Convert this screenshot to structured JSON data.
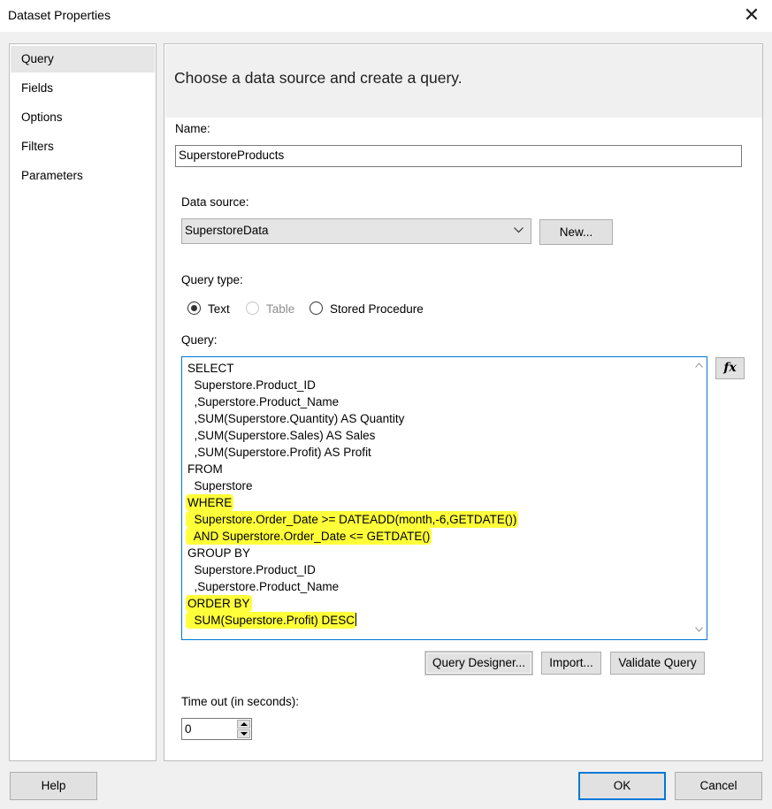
{
  "window": {
    "title": "Dataset Properties",
    "close_icon": "close-icon"
  },
  "sidebar": {
    "items": [
      {
        "label": "Query",
        "selected": true
      },
      {
        "label": "Fields",
        "selected": false
      },
      {
        "label": "Options",
        "selected": false
      },
      {
        "label": "Filters",
        "selected": false
      },
      {
        "label": "Parameters",
        "selected": false
      }
    ]
  },
  "panel": {
    "header": "Choose a data source and create a query.",
    "name_label": "Name:",
    "name_value": "SuperstoreProducts",
    "datasource_label": "Data source:",
    "datasource_value": "SuperstoreData",
    "new_button": "New...",
    "query_type_label": "Query type:",
    "query_types": [
      {
        "label": "Text",
        "selected": true,
        "enabled": true
      },
      {
        "label": "Table",
        "selected": false,
        "enabled": false
      },
      {
        "label": "Stored Procedure",
        "selected": false,
        "enabled": true
      }
    ],
    "query_label": "Query:",
    "query_lines": [
      {
        "text": "SELECT",
        "highlighted": false
      },
      {
        "text": "  Superstore.Product_ID",
        "highlighted": false
      },
      {
        "text": "  ,Superstore.Product_Name",
        "highlighted": false
      },
      {
        "text": "  ,SUM(Superstore.Quantity) AS Quantity",
        "highlighted": false
      },
      {
        "text": "  ,SUM(Superstore.Sales) AS Sales",
        "highlighted": false
      },
      {
        "text": "  ,SUM(Superstore.Profit) AS Profit",
        "highlighted": false
      },
      {
        "text": "FROM",
        "highlighted": false
      },
      {
        "text": "  Superstore",
        "highlighted": false
      },
      {
        "text": "WHERE",
        "highlighted": true
      },
      {
        "text": "  Superstore.Order_Date >= DATEADD(month,-6,GETDATE())",
        "highlighted": true
      },
      {
        "text": "  AND Superstore.Order_Date <= GETDATE()",
        "highlighted": true
      },
      {
        "text": "GROUP BY",
        "highlighted": false
      },
      {
        "text": "  Superstore.Product_ID",
        "highlighted": false
      },
      {
        "text": "  ,Superstore.Product_Name",
        "highlighted": false
      },
      {
        "text": "ORDER BY",
        "highlighted": true
      },
      {
        "text": "  SUM(Superstore.Profit) DESC",
        "highlighted": true
      }
    ],
    "fx_button": "fx",
    "query_designer_button": "Query Designer...",
    "import_button": "Import...",
    "validate_button": "Validate Query",
    "timeout_label": "Time out (in seconds):",
    "timeout_value": "0"
  },
  "footer": {
    "help_button": "Help",
    "ok_button": "OK",
    "cancel_button": "Cancel"
  },
  "colors": {
    "highlight": "#ffff3a",
    "accent": "#0078d7",
    "button_face": "#e1e1e1"
  }
}
